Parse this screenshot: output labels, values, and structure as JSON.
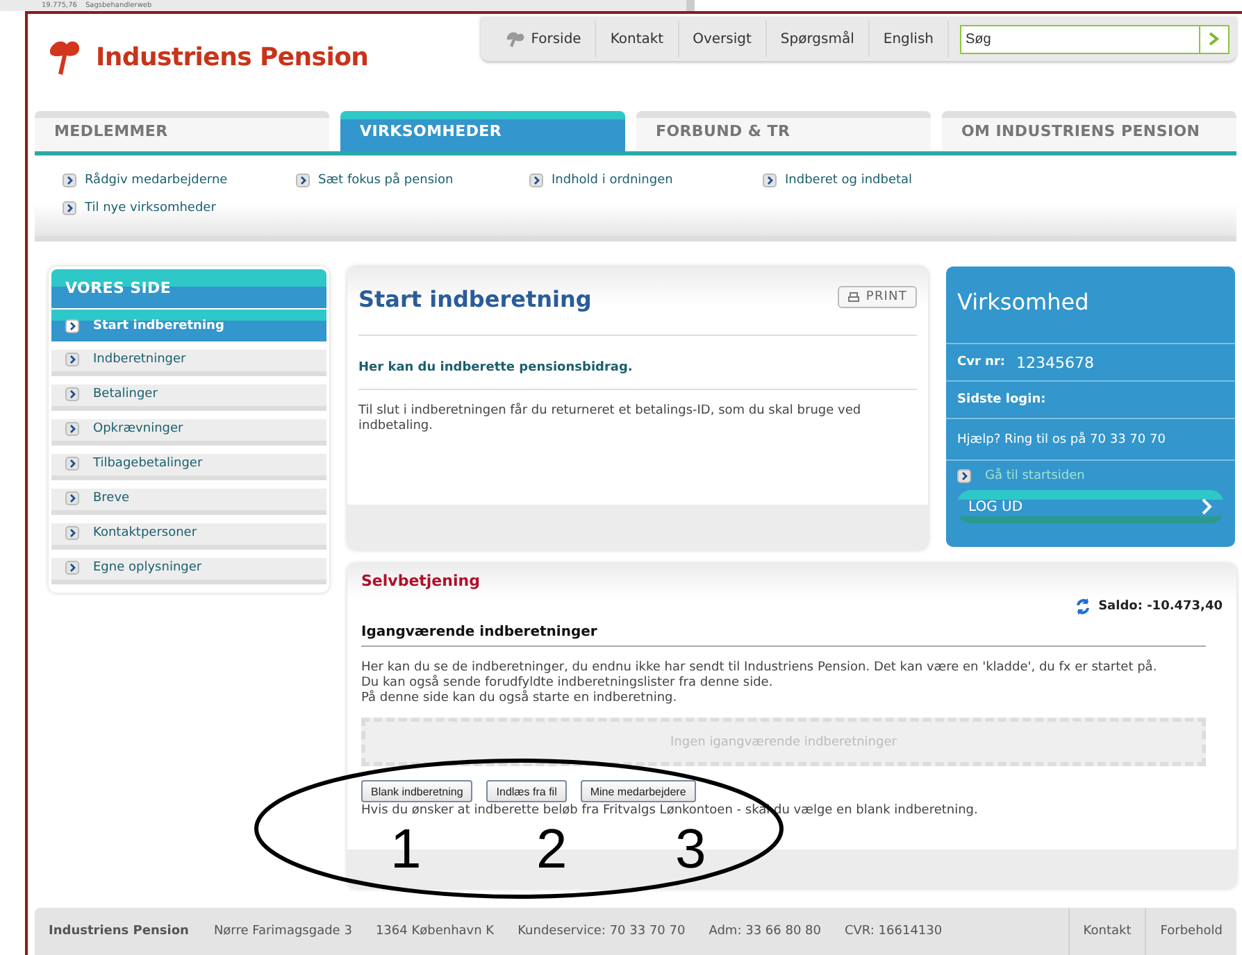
{
  "background_window": {
    "texts": [
      "19.775,76",
      "Sagsbehandlerweb"
    ]
  },
  "logo": {
    "text": "Industriens Pension"
  },
  "top_links": [
    {
      "label": "Forside",
      "kind": "home"
    },
    {
      "label": "Kontakt",
      "kind": "plain"
    },
    {
      "label": "Oversigt",
      "kind": "plain"
    },
    {
      "label": "Spørgsmål",
      "kind": "plain"
    },
    {
      "label": "English",
      "kind": "plain"
    }
  ],
  "search": {
    "placeholder": "Søg"
  },
  "tabs": [
    {
      "label": "MEDLEMMER",
      "selected": false
    },
    {
      "label": "VIRKSOMHEDER",
      "selected": true
    },
    {
      "label": "FORBUND & TR",
      "selected": false
    },
    {
      "label": "OM INDUSTRIENS PENSION",
      "selected": false
    }
  ],
  "subnav": [
    "Rådgiv medarbejderne",
    "Sæt fokus på pension",
    "Indhold i ordningen",
    "Indberet og indbetal",
    "Til nye virksomheder"
  ],
  "sidebar": {
    "title": "VORES SIDE",
    "items": [
      {
        "label": "Start indberetning",
        "selected": true
      },
      {
        "label": "Indberetninger",
        "selected": false
      },
      {
        "label": "Betalinger",
        "selected": false
      },
      {
        "label": "Opkrævninger",
        "selected": false
      },
      {
        "label": "Tilbagebetalinger",
        "selected": false
      },
      {
        "label": "Breve",
        "selected": false
      },
      {
        "label": "Kontaktpersoner",
        "selected": false
      },
      {
        "label": "Egne oplysninger",
        "selected": false
      }
    ]
  },
  "main": {
    "title": "Start indberetning",
    "print": "PRINT",
    "lead": "Her kan du indberette pensionsbidrag.",
    "body": "Til slut i indberetningen får du returneret et betalings-ID, som du skal bruge ved indbetaling."
  },
  "company": {
    "title": "Virksomhed",
    "cvr_label": "Cvr nr:",
    "cvr": "12345678",
    "login_label": "Sidste login:",
    "help": "Hjælp? Ring til os på 70 33 70 70",
    "home_link": "Gå til startsiden",
    "logout": "LOG UD"
  },
  "selfservice": {
    "title": "Selvbetjening",
    "balance": "Saldo: -10.473,40",
    "heading": "Igangværende indberetninger",
    "paragraphs": [
      "Her kan du se de indberetninger, du endnu ikke har sendt til Industriens Pension. Det kan være en 'kladde', du fx er startet på.",
      "Du kan også sende forudfyldte indberetningslister fra denne side.",
      "På denne side kan du også starte en indberetning."
    ],
    "empty": "Ingen igangværende indberetninger",
    "buttons": [
      "Blank indberetning",
      "Indlæs fra fil",
      "Mine medarbejdere"
    ],
    "note": "Hvis du ønsker at indberette beløb fra Fritvalgs Lønkontoen - skal du vælge en blank indberetning."
  },
  "annotation": {
    "numbers": [
      "1",
      "2",
      "3"
    ]
  },
  "footer": {
    "items": [
      "Industriens Pension",
      "Nørre Farimagsgade 3",
      "1364 København K",
      "Kundeservice: 70 33 70 70",
      "Adm: 33 66 80 80",
      "CVR: 16614130"
    ],
    "links": [
      "Kontakt",
      "Forbehold"
    ]
  }
}
